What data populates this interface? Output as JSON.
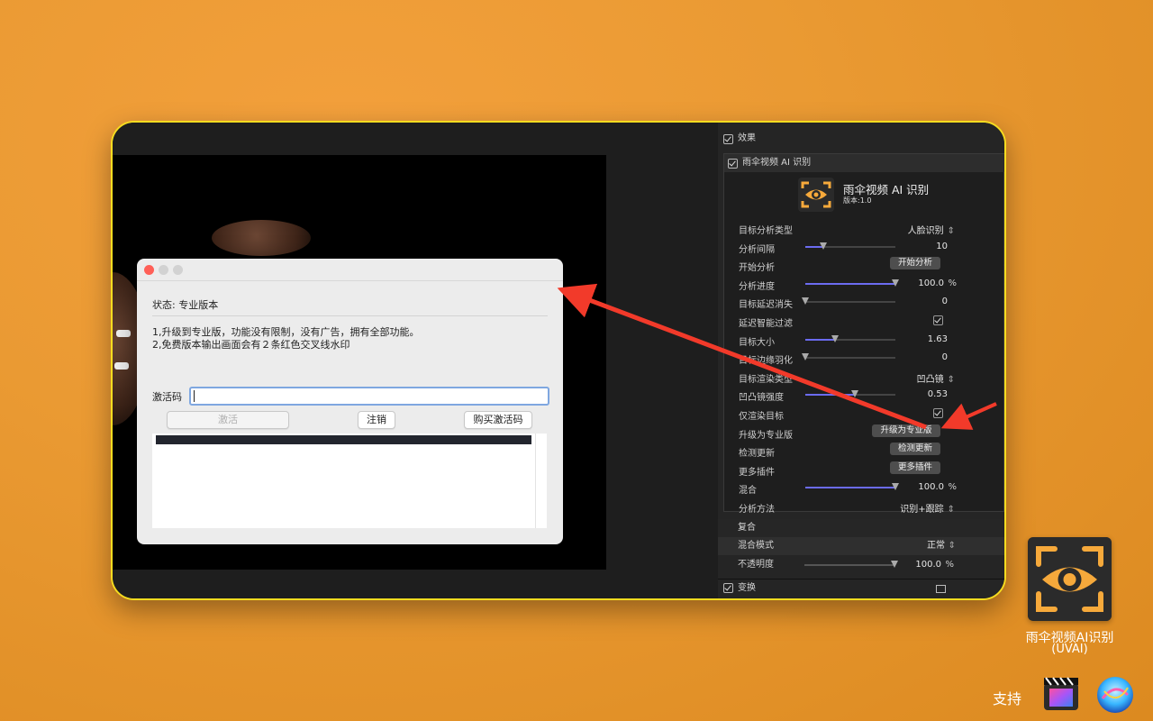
{
  "dialog": {
    "status": "状态: 专业版本",
    "note1": "1,升级到专业版，功能没有限制，没有广告，拥有全部功能。",
    "note2": "2,免费版本输出画面会有２条红色交叉线水印",
    "activation_label": "激活码",
    "activation_value": "",
    "activate_button": "激活",
    "logout_button": "注销",
    "buy_button": "购买激活码"
  },
  "inspector": {
    "effects_label": "效果",
    "plugin_section_label": "雨伞视频 AI 识别",
    "plugin_title": "雨伞视频 AI 识别",
    "plugin_version": "版本:1.0",
    "params": [
      {
        "label": "目标分析类型",
        "kind": "select",
        "value": "人脸识别"
      },
      {
        "label": "分析间隔",
        "kind": "slider",
        "value": "10",
        "level": 0.2
      },
      {
        "label": "开始分析",
        "kind": "button",
        "value": "开始分析"
      },
      {
        "label": "分析进度",
        "kind": "slider",
        "value": "100.0",
        "unit": "%",
        "level": 1.0
      },
      {
        "label": "目标延迟消失",
        "kind": "slider",
        "value": "0",
        "level": 0.0
      },
      {
        "label": "延迟智能过滤",
        "kind": "checkbox"
      },
      {
        "label": "目标大小",
        "kind": "slider",
        "value": "1.63",
        "level": 0.33
      },
      {
        "label": "目标边缘羽化",
        "kind": "slider",
        "value": "0",
        "level": 0.0
      },
      {
        "label": "目标渲染类型",
        "kind": "select",
        "value": "凹凸镜"
      },
      {
        "label": "凹凸镜强度",
        "kind": "slider",
        "value": "0.53",
        "level": 0.55
      },
      {
        "label": "仅渲染目标",
        "kind": "checkbox"
      },
      {
        "label": "升级为专业版",
        "kind": "button",
        "value": "升级为专业版"
      },
      {
        "label": "检测更新",
        "kind": "button",
        "value": "检测更新"
      },
      {
        "label": "更多插件",
        "kind": "button",
        "value": "更多插件"
      },
      {
        "label": "混合",
        "kind": "slider",
        "value": "100.0",
        "unit": "%",
        "level": 1.0
      },
      {
        "label": "分析方法",
        "kind": "select",
        "value": "识别+跟踪"
      }
    ],
    "composite_label": "复合",
    "blend_mode_label": "混合模式",
    "blend_mode_value": "正常",
    "opacity_label": "不透明度",
    "opacity_value": "100.0",
    "opacity_unit": "%",
    "opacity_level": 1.0,
    "transform_label": "变换"
  },
  "branding": {
    "app_name": "雨伞视频AI识别",
    "app_code": "(UVAI)",
    "support_label": "支持",
    "accent": "#f6a93b",
    "arrow_color": "#f23a2a"
  }
}
